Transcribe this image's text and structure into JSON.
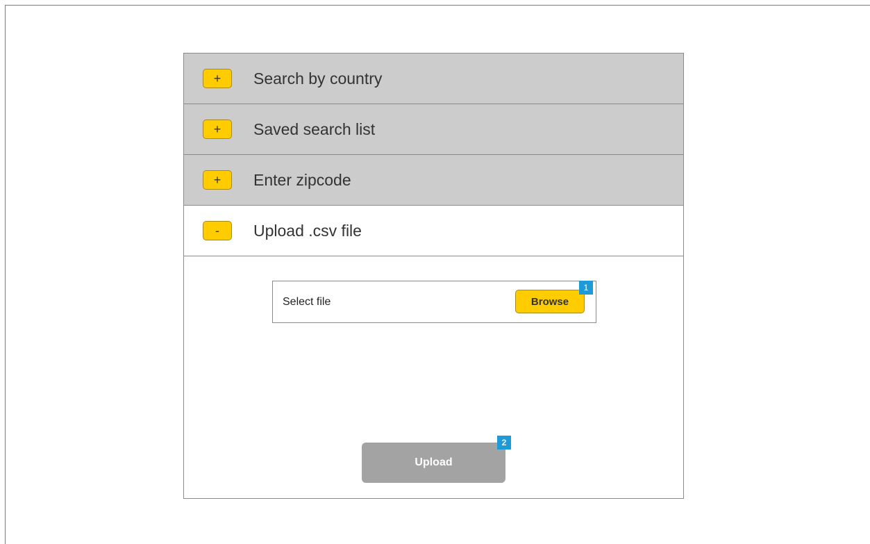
{
  "accordion": {
    "sections": [
      {
        "toggle": "+",
        "title": "Search by country",
        "expanded": false
      },
      {
        "toggle": "+",
        "title": "Saved search list",
        "expanded": false
      },
      {
        "toggle": "+",
        "title": "Enter zipcode",
        "expanded": false
      },
      {
        "toggle": "-",
        "title": "Upload .csv file",
        "expanded": true
      }
    ]
  },
  "upload_panel": {
    "file_label": "Select file",
    "browse_label": "Browse",
    "browse_badge": "1",
    "upload_label": "Upload",
    "upload_badge": "2"
  },
  "colors": {
    "toggle_bg": "#ffcc00",
    "collapsed_header_bg": "#cccccc",
    "badge_bg": "#1e9ad6",
    "upload_btn_bg": "#a3a3a3"
  },
  "icons": {
    "expand": "plus-icon",
    "collapse": "minus-icon"
  }
}
